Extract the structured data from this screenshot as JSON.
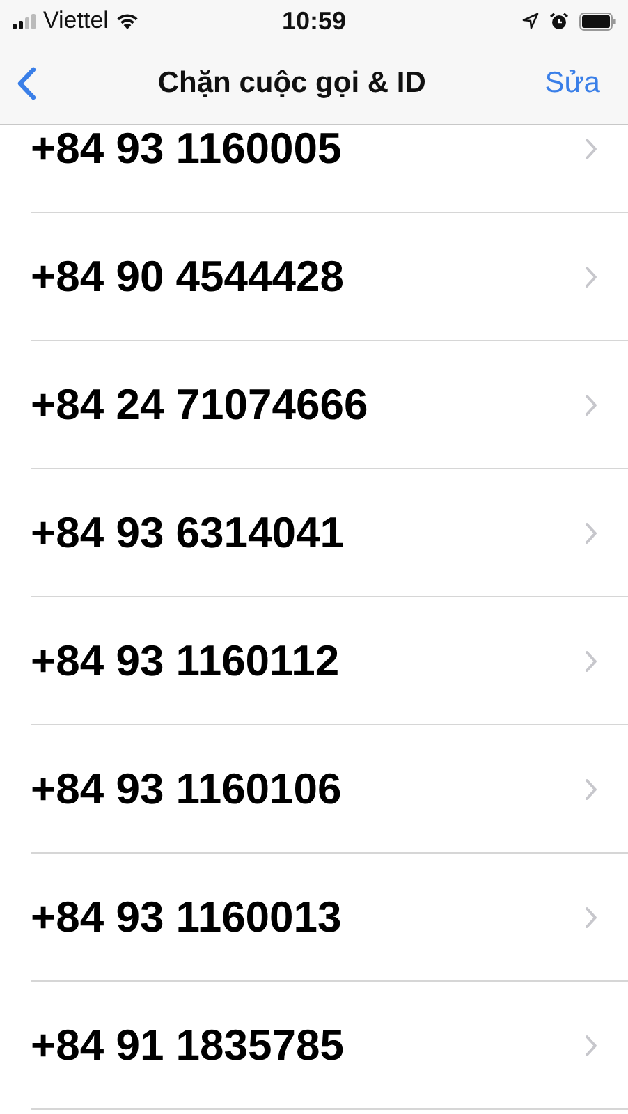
{
  "status_bar": {
    "carrier": "Viettel",
    "time": "10:59"
  },
  "nav": {
    "title": "Chặn cuộc gọi & ID",
    "action": "Sửa"
  },
  "numbers": [
    {
      "number": "+84 93 1160005"
    },
    {
      "number": "+84 90 4544428"
    },
    {
      "number": "+84 24 71074666"
    },
    {
      "number": "+84 93 6314041"
    },
    {
      "number": "+84 93 1160112"
    },
    {
      "number": "+84 93 1160106"
    },
    {
      "number": "+84 93 1160013"
    },
    {
      "number": "+84 91 1835785"
    }
  ]
}
